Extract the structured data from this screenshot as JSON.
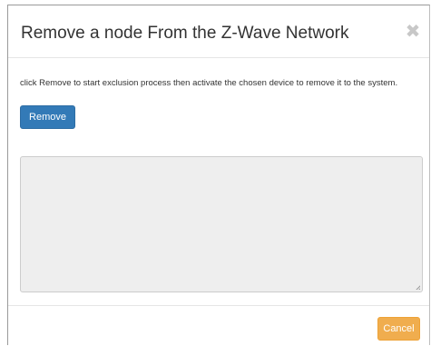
{
  "dialog": {
    "title": "Remove a node From the Z-Wave Network",
    "close_icon": "close-icon",
    "close_glyph": "✖"
  },
  "body": {
    "instructions": "click Remove to start exclusion process then activate the chosen device to remove it to the system.",
    "remove_label": "Remove",
    "log_value": ""
  },
  "footer": {
    "cancel_label": "Cancel"
  },
  "colors": {
    "primary": "#337ab7",
    "warning": "#f0ad4e",
    "log_background": "#eeeeee"
  }
}
